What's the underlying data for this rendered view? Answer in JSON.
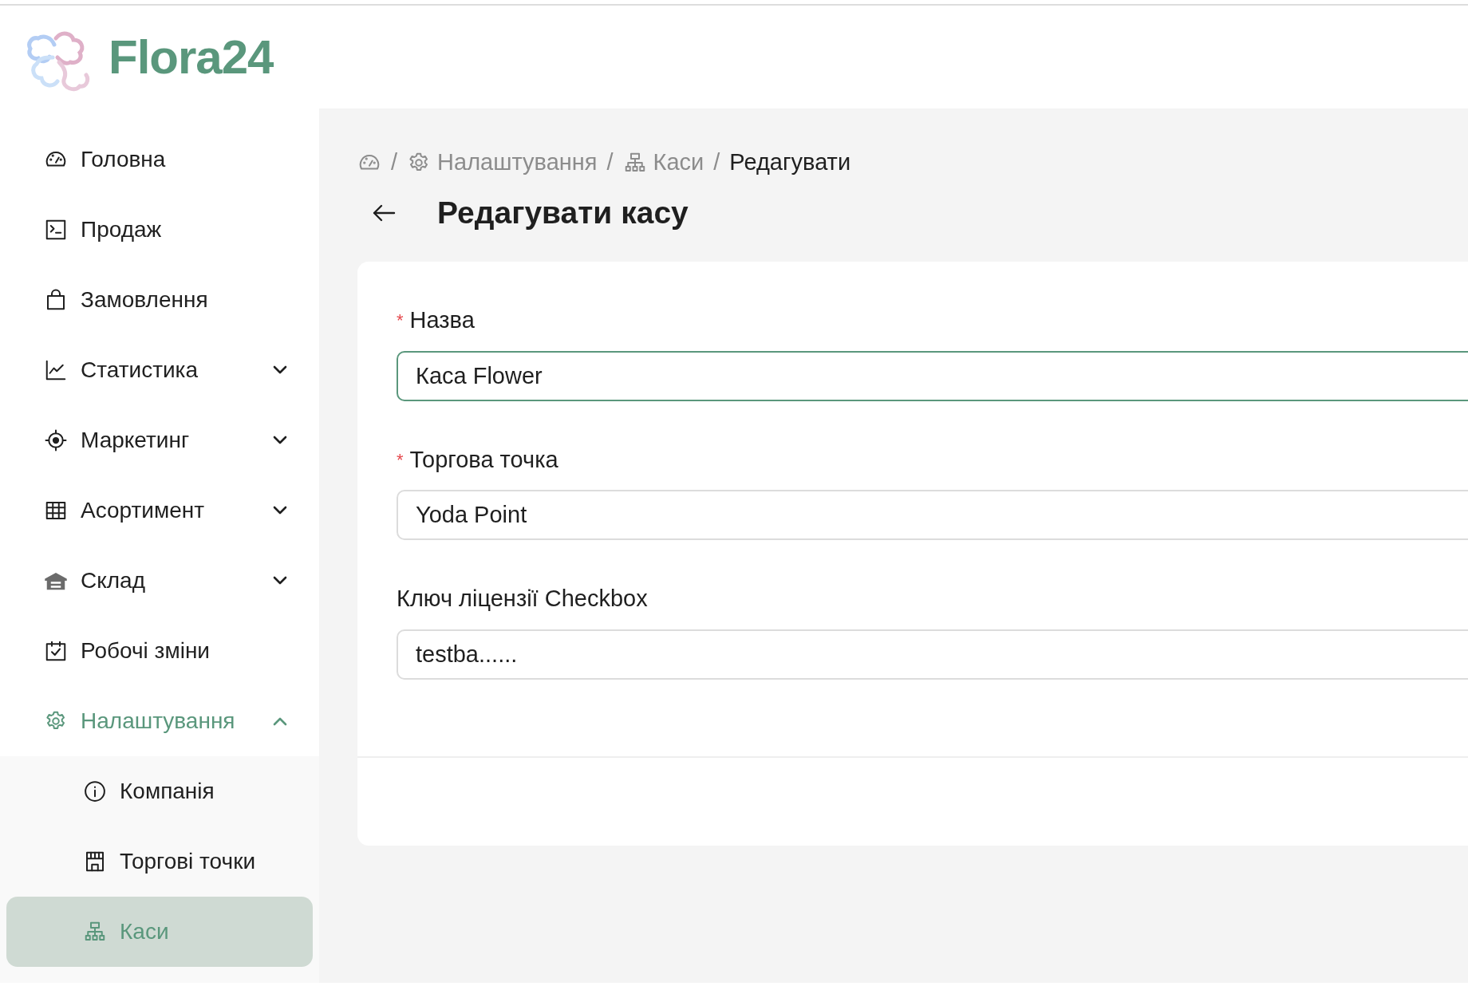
{
  "logo": {
    "text": "Flora24"
  },
  "sidebar": {
    "items": [
      {
        "label": "Головна",
        "kind": "link",
        "selected": false
      },
      {
        "label": "Продаж",
        "kind": "link",
        "selected": false
      },
      {
        "label": "Замовлення",
        "kind": "link",
        "selected": false
      },
      {
        "label": "Статистика",
        "kind": "group",
        "selected": false,
        "expanded": false
      },
      {
        "label": "Маркетинг",
        "kind": "group",
        "selected": false,
        "expanded": false
      },
      {
        "label": "Асортимент",
        "kind": "group",
        "selected": false,
        "expanded": false
      },
      {
        "label": "Склад",
        "kind": "group",
        "selected": false,
        "expanded": false
      },
      {
        "label": "Робочі зміни",
        "kind": "link",
        "selected": false
      },
      {
        "label": "Налаштування",
        "kind": "group",
        "selected": true,
        "expanded": true,
        "children": [
          {
            "label": "Компанія",
            "selected": false
          },
          {
            "label": "Торгові точки",
            "selected": false
          },
          {
            "label": "Каси",
            "selected": true
          }
        ]
      }
    ]
  },
  "breadcrumb": [
    {
      "kind": "home"
    },
    {
      "kind": "link",
      "separator": "/",
      "label": "Налаштування"
    },
    {
      "kind": "link",
      "separator": "/",
      "label": "Каси"
    },
    {
      "kind": "current",
      "separator": "/",
      "label": "Редагувати"
    }
  ],
  "page_title": "Редагувати касу",
  "form": {
    "fields": [
      {
        "required_mark": "*",
        "label": "Назва",
        "focused": true,
        "value": "Каса Flower"
      },
      {
        "required_mark": "*",
        "label": "Торгова точка",
        "focused": false,
        "value": "Yoda Point"
      },
      {
        "label": "Ключ ліцензії Checkbox",
        "focused": false,
        "value": "testba......"
      }
    ]
  }
}
